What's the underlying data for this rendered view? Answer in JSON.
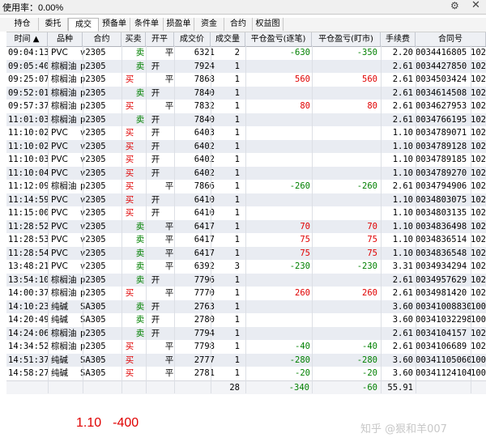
{
  "topbar": {
    "usage_label": "使用率：",
    "usage_value": "0.00%"
  },
  "tabs": [
    "持仓",
    "委托",
    "成交",
    "预备单",
    "条件单",
    "损盈单",
    "资金",
    "合约",
    "权益图"
  ],
  "active_tab": "成交",
  "columns": [
    "时间 ▲",
    "品种",
    "合约",
    "买卖",
    "开平",
    "成交价",
    "成交量",
    "平仓盈亏(逐笔)",
    "平仓盈亏(盯市)",
    "手续费",
    "合同号"
  ],
  "rows": [
    [
      "09:04:13",
      "PVC",
      "v2305",
      "卖",
      "平",
      "6321",
      "2",
      "-630",
      "-350",
      "2.20",
      "0034416805",
      "102"
    ],
    [
      "09:05:40",
      "棕榈油",
      "p2305",
      "卖",
      "开",
      "7924",
      "1",
      "",
      "",
      "2.61",
      "0034427850",
      "102"
    ],
    [
      "09:25:07",
      "棕榈油",
      "p2305",
      "买",
      "平",
      "7868",
      "1",
      "560",
      "560",
      "2.61",
      "0034503424",
      "102"
    ],
    [
      "09:52:01",
      "棕榈油",
      "p2305",
      "卖",
      "开",
      "7840",
      "1",
      "",
      "",
      "2.61",
      "0034614508",
      "102"
    ],
    [
      "09:57:37",
      "棕榈油",
      "p2305",
      "买",
      "平",
      "7832",
      "1",
      "80",
      "80",
      "2.61",
      "0034627953",
      "102"
    ],
    [
      "11:01:03",
      "棕榈油",
      "p2305",
      "卖",
      "开",
      "7840",
      "1",
      "",
      "",
      "2.61",
      "0034766195",
      "102"
    ],
    [
      "11:10:02",
      "PVC",
      "v2305",
      "买",
      "开",
      "6403",
      "1",
      "",
      "",
      "1.10",
      "0034789071",
      "102"
    ],
    [
      "11:10:02",
      "PVC",
      "v2305",
      "买",
      "开",
      "6402",
      "1",
      "",
      "",
      "1.10",
      "0034789128",
      "102"
    ],
    [
      "11:10:03",
      "PVC",
      "v2305",
      "买",
      "开",
      "6402",
      "1",
      "",
      "",
      "1.10",
      "0034789185",
      "102"
    ],
    [
      "11:10:04",
      "PVC",
      "v2305",
      "买",
      "开",
      "6402",
      "1",
      "",
      "",
      "1.10",
      "0034789270",
      "102"
    ],
    [
      "11:12:09",
      "棕榈油",
      "p2305",
      "买",
      "平",
      "7866",
      "1",
      "-260",
      "-260",
      "2.61",
      "0034794906",
      "102"
    ],
    [
      "11:14:59",
      "PVC",
      "v2305",
      "买",
      "开",
      "6410",
      "1",
      "",
      "",
      "1.10",
      "0034803075",
      "102"
    ],
    [
      "11:15:00",
      "PVC",
      "v2305",
      "买",
      "开",
      "6410",
      "1",
      "",
      "",
      "1.10",
      "0034803135",
      "102"
    ],
    [
      "11:28:52",
      "PVC",
      "v2305",
      "卖",
      "平",
      "6417",
      "1",
      "70",
      "70",
      "1.10",
      "0034836498",
      "102"
    ],
    [
      "11:28:53",
      "PVC",
      "v2305",
      "卖",
      "平",
      "6417",
      "1",
      "75",
      "75",
      "1.10",
      "0034836514",
      "102"
    ],
    [
      "11:28:54",
      "PVC",
      "v2305",
      "卖",
      "平",
      "6417",
      "1",
      "75",
      "75",
      "1.10",
      "0034836548",
      "102"
    ],
    [
      "13:48:21",
      "PVC",
      "v2305",
      "卖",
      "平",
      "6392",
      "3",
      "-230",
      "-230",
      "3.31",
      "0034934294",
      "102"
    ],
    [
      "13:54:10",
      "棕榈油",
      "p2305",
      "卖",
      "开",
      "7796",
      "1",
      "",
      "",
      "2.61",
      "0034957629",
      "102"
    ],
    [
      "14:00:37",
      "棕榈油",
      "p2305",
      "买",
      "平",
      "7770",
      "1",
      "260",
      "260",
      "2.61",
      "0034981420",
      "102"
    ],
    [
      "14:10:23",
      "纯碱",
      "SA305",
      "卖",
      "开",
      "2763",
      "1",
      "",
      "",
      "3.60",
      "00341008830",
      "100"
    ],
    [
      "14:20:49",
      "纯碱",
      "SA305",
      "卖",
      "开",
      "2780",
      "1",
      "",
      "",
      "3.60",
      "00341032298",
      "100"
    ],
    [
      "14:24:06",
      "棕榈油",
      "p2305",
      "卖",
      "开",
      "7794",
      "1",
      "",
      "",
      "2.61",
      "0034104157",
      "102"
    ],
    [
      "14:34:52",
      "棕榈油",
      "p2305",
      "买",
      "平",
      "7798",
      "1",
      "-40",
      "-40",
      "2.61",
      "0034106689",
      "102"
    ],
    [
      "14:51:37",
      "纯碱",
      "SA305",
      "买",
      "平",
      "2777",
      "1",
      "-280",
      "-280",
      "3.60",
      "00341105060",
      "100"
    ],
    [
      "14:58:27",
      "纯碱",
      "SA305",
      "买",
      "平",
      "2781",
      "1",
      "-20",
      "-20",
      "3.60",
      "00341124104",
      "100"
    ]
  ],
  "totals": {
    "volume": "28",
    "pnl_trade": "-340",
    "pnl_mtm": "-60",
    "fee": "55.91"
  },
  "annotation": {
    "a": "1.10",
    "b": "-400"
  },
  "watermark": "知乎 @狠和羊007",
  "colors": {
    "buy": "#e00000",
    "sell": "#008000",
    "row_alt": "#e9ecf2"
  }
}
